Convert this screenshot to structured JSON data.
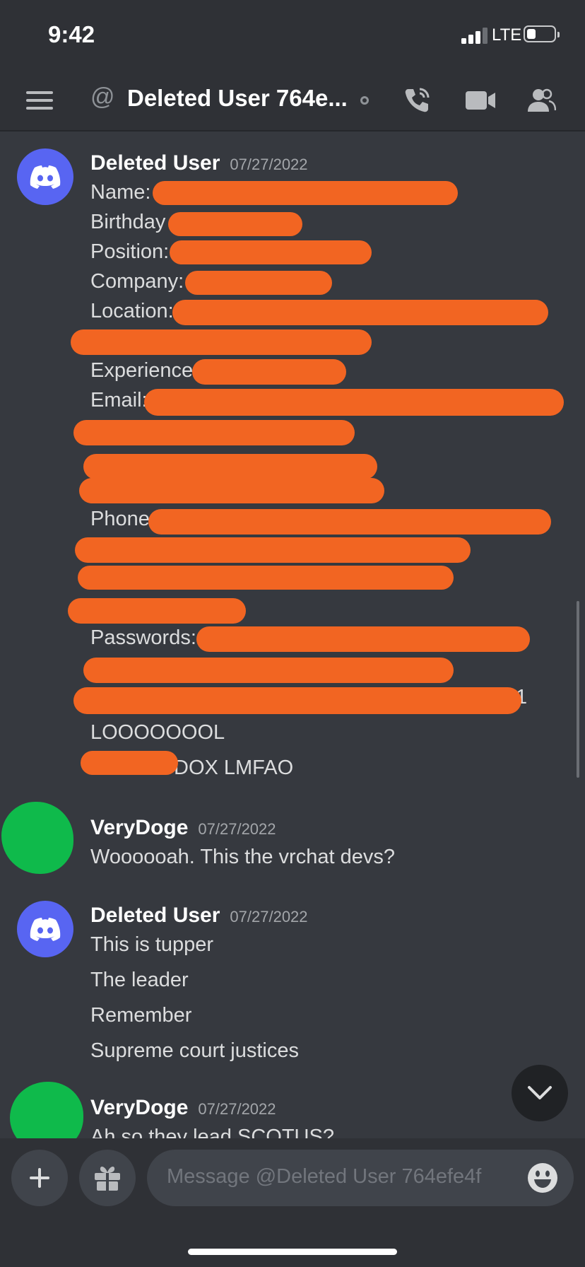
{
  "status_bar": {
    "time": "9:42",
    "network": "LTE"
  },
  "header": {
    "title": "Deleted User 764e...",
    "icons": [
      "menu-icon",
      "at-icon",
      "call-icon",
      "video-icon",
      "members-icon"
    ]
  },
  "messages": [
    {
      "author": "Deleted User",
      "date": "07/27/2022",
      "lines": [
        "Name:",
        "Birthday",
        "Position:",
        "Company:",
        "Location:",
        "Experience",
        "Email:",
        "Phone",
        "Passwords:",
        "1",
        "LOOOOOOOL",
        "DOX LMFAO"
      ]
    },
    {
      "author": "VeryDoge",
      "date": "07/27/2022",
      "lines": [
        "Woooooah. This the vrchat devs?"
      ]
    },
    {
      "author": "Deleted User",
      "date": "07/27/2022",
      "lines": [
        "This is tupper",
        "The leader",
        "Remember",
        "Supreme court justices"
      ]
    },
    {
      "author": "VeryDoge",
      "date": "07/27/2022",
      "lines": [
        "Ah so they lead SCOTUS?"
      ]
    }
  ],
  "composer": {
    "placeholder": "Message @Deleted User 764efe4f"
  },
  "colors": {
    "background": "#36393f",
    "header": "#2f3136",
    "blurple": "#5865f2",
    "redaction": "#f26522",
    "avatar_scribble": "#0fba4b"
  }
}
